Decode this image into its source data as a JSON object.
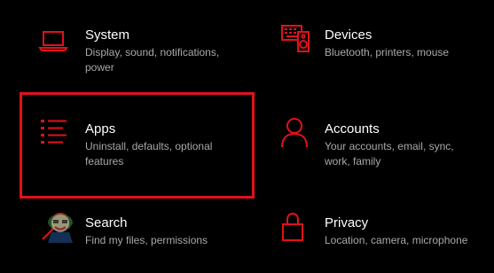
{
  "accent_color": "#e1111b",
  "title_color": "#ffffff",
  "description_color": "#a8a8a8",
  "background_color": "#000000",
  "tiles": {
    "system": {
      "icon": "laptop-icon",
      "title": "System",
      "description": "Display, sound, notifications, power"
    },
    "devices": {
      "icon": "keyboard-speaker-icon",
      "title": "Devices",
      "description": "Bluetooth, printers, mouse"
    },
    "apps": {
      "icon": "apps-list-icon",
      "title": "Apps",
      "description": "Uninstall, defaults, optional features"
    },
    "accounts": {
      "icon": "person-icon",
      "title": "Accounts",
      "description": "Your accounts, email, sync, work, family"
    },
    "search": {
      "icon": "magnifier-icon",
      "title": "Search",
      "description": "Find my files, permissions"
    },
    "privacy": {
      "icon": "lock-icon",
      "title": "Privacy",
      "description": "Location, camera, microphone"
    }
  },
  "highlighted_tile": "apps"
}
